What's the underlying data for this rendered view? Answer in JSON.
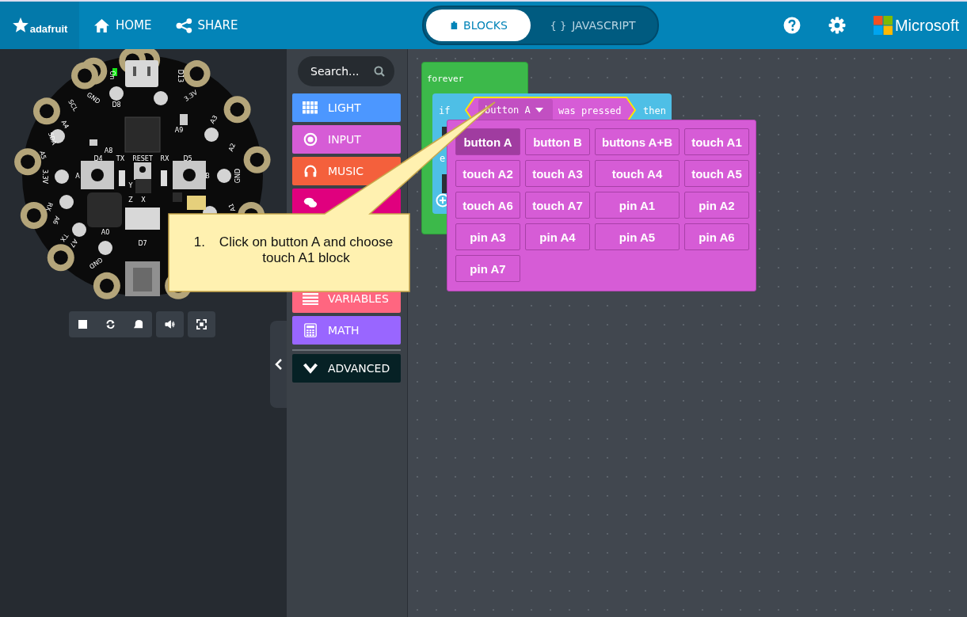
{
  "header": {
    "brand": "adafruit",
    "nav": [
      {
        "kind": "home",
        "label": "HOME"
      },
      {
        "kind": "share",
        "label": "SHARE"
      }
    ],
    "editor_tabs": [
      {
        "label": "BLOCKS",
        "selected": true
      },
      {
        "icon": "{ }",
        "label": "JAVASCRIPT",
        "selected": false
      }
    ],
    "partner": "Microsoft"
  },
  "simulator": {
    "board_labels": [
      "On",
      "D13",
      "GND",
      "D8",
      "3.3V",
      "SCL",
      "A4",
      "A3",
      "SDA",
      "A5",
      "A9",
      "A8",
      "A2",
      "D4",
      "TX",
      "RESET",
      "RX",
      "D5",
      "A",
      "B",
      "3.3V",
      "GND",
      "Y",
      "Z",
      "X",
      "RX",
      "A6",
      "A1",
      "A0",
      "D7",
      "TX",
      "A7",
      "GND"
    ]
  },
  "toolbox": {
    "search": {
      "placeholder": "Search..."
    },
    "categories": [
      {
        "kind": "grid",
        "label": "LIGHT",
        "color": "#4c97ff"
      },
      {
        "kind": "target",
        "label": "INPUT",
        "color": "#d65cd6"
      },
      {
        "kind": "headphones",
        "label": "MUSIC",
        "color": "#f4603c"
      },
      {
        "kind": "chat",
        "color": "#e0007e"
      },
      {
        "kind": "lines",
        "label": "VARIABLES",
        "color": "#ff6680"
      },
      {
        "kind": "calculator",
        "label": "MATH",
        "color": "#9966ff"
      }
    ],
    "advanced": "ADVANCED"
  },
  "workspace": {
    "forever": "forever",
    "if": "if",
    "field_value": "button A",
    "condition": "was pressed",
    "then": "then",
    "else_fragment": "e",
    "dropdown_options": [
      {
        "label": "button A",
        "selected": true
      },
      {
        "label": "button B",
        "selected": false
      },
      {
        "label": "buttons A+B",
        "selected": false
      },
      {
        "label": "touch A1",
        "selected": false
      },
      {
        "label": "touch A2",
        "selected": false
      },
      {
        "label": "touch A3",
        "selected": false
      },
      {
        "label": "touch A4",
        "selected": false
      },
      {
        "label": "touch A5",
        "selected": false
      },
      {
        "label": "touch A6",
        "selected": false
      },
      {
        "label": "touch A7",
        "selected": false
      },
      {
        "label": "pin A1",
        "selected": false
      },
      {
        "label": "pin A2",
        "selected": false
      },
      {
        "label": "pin A3",
        "selected": false
      },
      {
        "label": "pin A4",
        "selected": false
      },
      {
        "label": "pin A5",
        "selected": false
      },
      {
        "label": "pin A6",
        "selected": false
      },
      {
        "label": "pin A7",
        "selected": false
      }
    ]
  },
  "callout": {
    "number": "1.",
    "text": "Click on button A and choose touch A1 block"
  }
}
